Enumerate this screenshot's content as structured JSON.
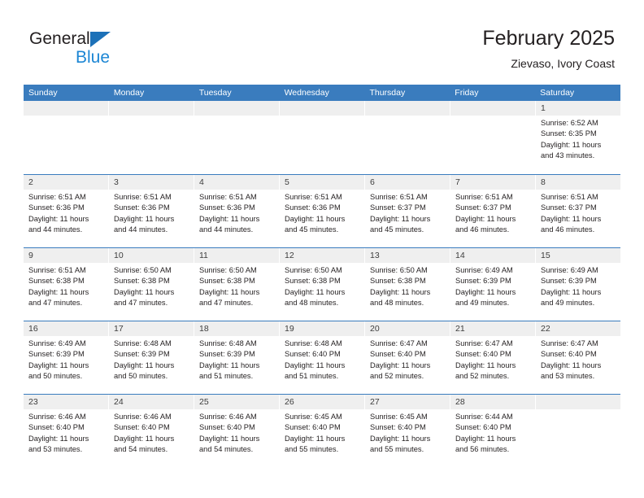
{
  "logo": {
    "word_one": "General",
    "word_two": "Blue",
    "triangle_icon": "triangle-icon",
    "brand_dark": "#231f20",
    "brand_blue": "#1c86d4",
    "brand_triangle": "#1c71b8"
  },
  "header": {
    "month_title": "February 2025",
    "location": "Zievaso, Ivory Coast"
  },
  "theme": {
    "header_row_bg": "#3a7cbe",
    "daynum_bg": "#efefef",
    "text": "#231f20"
  },
  "calendar": {
    "weekday_headers": [
      "Sunday",
      "Monday",
      "Tuesday",
      "Wednesday",
      "Thursday",
      "Friday",
      "Saturday"
    ],
    "weeks": [
      [
        {
          "day": "",
          "empty": true
        },
        {
          "day": "",
          "empty": true
        },
        {
          "day": "",
          "empty": true
        },
        {
          "day": "",
          "empty": true
        },
        {
          "day": "",
          "empty": true
        },
        {
          "day": "",
          "empty": true
        },
        {
          "day": "1",
          "sunrise": "Sunrise: 6:52 AM",
          "sunset": "Sunset: 6:35 PM",
          "daylight": "Daylight: 11 hours and 43 minutes."
        }
      ],
      [
        {
          "day": "2",
          "sunrise": "Sunrise: 6:51 AM",
          "sunset": "Sunset: 6:36 PM",
          "daylight": "Daylight: 11 hours and 44 minutes."
        },
        {
          "day": "3",
          "sunrise": "Sunrise: 6:51 AM",
          "sunset": "Sunset: 6:36 PM",
          "daylight": "Daylight: 11 hours and 44 minutes."
        },
        {
          "day": "4",
          "sunrise": "Sunrise: 6:51 AM",
          "sunset": "Sunset: 6:36 PM",
          "daylight": "Daylight: 11 hours and 44 minutes."
        },
        {
          "day": "5",
          "sunrise": "Sunrise: 6:51 AM",
          "sunset": "Sunset: 6:36 PM",
          "daylight": "Daylight: 11 hours and 45 minutes."
        },
        {
          "day": "6",
          "sunrise": "Sunrise: 6:51 AM",
          "sunset": "Sunset: 6:37 PM",
          "daylight": "Daylight: 11 hours and 45 minutes."
        },
        {
          "day": "7",
          "sunrise": "Sunrise: 6:51 AM",
          "sunset": "Sunset: 6:37 PM",
          "daylight": "Daylight: 11 hours and 46 minutes."
        },
        {
          "day": "8",
          "sunrise": "Sunrise: 6:51 AM",
          "sunset": "Sunset: 6:37 PM",
          "daylight": "Daylight: 11 hours and 46 minutes."
        }
      ],
      [
        {
          "day": "9",
          "sunrise": "Sunrise: 6:51 AM",
          "sunset": "Sunset: 6:38 PM",
          "daylight": "Daylight: 11 hours and 47 minutes."
        },
        {
          "day": "10",
          "sunrise": "Sunrise: 6:50 AM",
          "sunset": "Sunset: 6:38 PM",
          "daylight": "Daylight: 11 hours and 47 minutes."
        },
        {
          "day": "11",
          "sunrise": "Sunrise: 6:50 AM",
          "sunset": "Sunset: 6:38 PM",
          "daylight": "Daylight: 11 hours and 47 minutes."
        },
        {
          "day": "12",
          "sunrise": "Sunrise: 6:50 AM",
          "sunset": "Sunset: 6:38 PM",
          "daylight": "Daylight: 11 hours and 48 minutes."
        },
        {
          "day": "13",
          "sunrise": "Sunrise: 6:50 AM",
          "sunset": "Sunset: 6:38 PM",
          "daylight": "Daylight: 11 hours and 48 minutes."
        },
        {
          "day": "14",
          "sunrise": "Sunrise: 6:49 AM",
          "sunset": "Sunset: 6:39 PM",
          "daylight": "Daylight: 11 hours and 49 minutes."
        },
        {
          "day": "15",
          "sunrise": "Sunrise: 6:49 AM",
          "sunset": "Sunset: 6:39 PM",
          "daylight": "Daylight: 11 hours and 49 minutes."
        }
      ],
      [
        {
          "day": "16",
          "sunrise": "Sunrise: 6:49 AM",
          "sunset": "Sunset: 6:39 PM",
          "daylight": "Daylight: 11 hours and 50 minutes."
        },
        {
          "day": "17",
          "sunrise": "Sunrise: 6:48 AM",
          "sunset": "Sunset: 6:39 PM",
          "daylight": "Daylight: 11 hours and 50 minutes."
        },
        {
          "day": "18",
          "sunrise": "Sunrise: 6:48 AM",
          "sunset": "Sunset: 6:39 PM",
          "daylight": "Daylight: 11 hours and 51 minutes."
        },
        {
          "day": "19",
          "sunrise": "Sunrise: 6:48 AM",
          "sunset": "Sunset: 6:40 PM",
          "daylight": "Daylight: 11 hours and 51 minutes."
        },
        {
          "day": "20",
          "sunrise": "Sunrise: 6:47 AM",
          "sunset": "Sunset: 6:40 PM",
          "daylight": "Daylight: 11 hours and 52 minutes."
        },
        {
          "day": "21",
          "sunrise": "Sunrise: 6:47 AM",
          "sunset": "Sunset: 6:40 PM",
          "daylight": "Daylight: 11 hours and 52 minutes."
        },
        {
          "day": "22",
          "sunrise": "Sunrise: 6:47 AM",
          "sunset": "Sunset: 6:40 PM",
          "daylight": "Daylight: 11 hours and 53 minutes."
        }
      ],
      [
        {
          "day": "23",
          "sunrise": "Sunrise: 6:46 AM",
          "sunset": "Sunset: 6:40 PM",
          "daylight": "Daylight: 11 hours and 53 minutes."
        },
        {
          "day": "24",
          "sunrise": "Sunrise: 6:46 AM",
          "sunset": "Sunset: 6:40 PM",
          "daylight": "Daylight: 11 hours and 54 minutes."
        },
        {
          "day": "25",
          "sunrise": "Sunrise: 6:46 AM",
          "sunset": "Sunset: 6:40 PM",
          "daylight": "Daylight: 11 hours and 54 minutes."
        },
        {
          "day": "26",
          "sunrise": "Sunrise: 6:45 AM",
          "sunset": "Sunset: 6:40 PM",
          "daylight": "Daylight: 11 hours and 55 minutes."
        },
        {
          "day": "27",
          "sunrise": "Sunrise: 6:45 AM",
          "sunset": "Sunset: 6:40 PM",
          "daylight": "Daylight: 11 hours and 55 minutes."
        },
        {
          "day": "28",
          "sunrise": "Sunrise: 6:44 AM",
          "sunset": "Sunset: 6:40 PM",
          "daylight": "Daylight: 11 hours and 56 minutes."
        },
        {
          "day": "",
          "empty": true
        }
      ]
    ]
  }
}
